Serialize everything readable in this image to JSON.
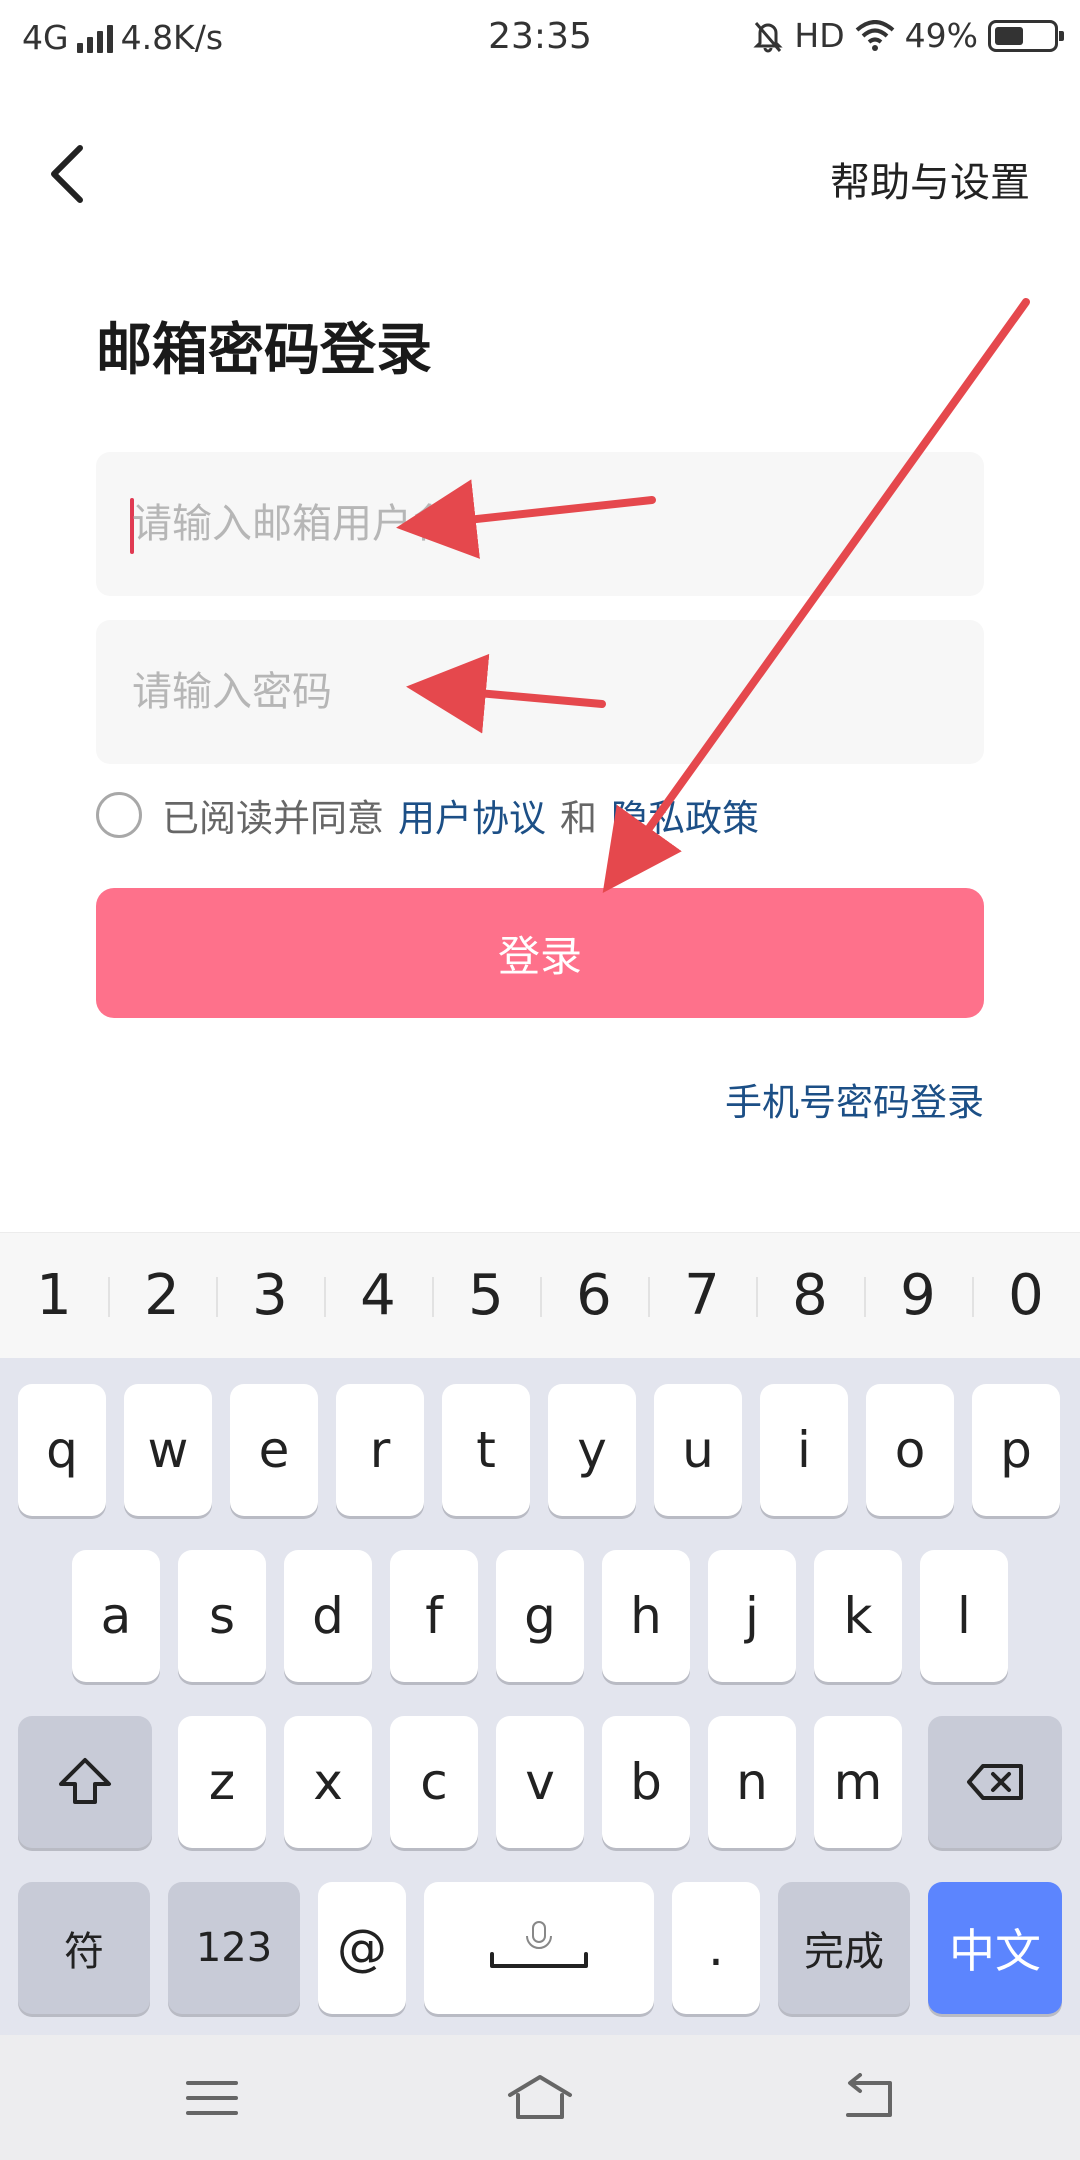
{
  "status_bar": {
    "network": "4G",
    "speed": "4.8K/s",
    "time": "23:35",
    "hd": "HD",
    "battery_text": "49%",
    "battery_level": 0.49
  },
  "header": {
    "back_icon": "chevron-left-icon",
    "help": "帮助与设置"
  },
  "title": "邮箱密码登录",
  "form": {
    "email_placeholder": "请输入邮箱用户名",
    "password_placeholder": "请输入密码"
  },
  "agreement": {
    "prefix": "已阅读并同意",
    "user_agreement": "用户协议",
    "and": "和",
    "privacy_policy": "隐私政策",
    "checked": false
  },
  "login_button": "登录",
  "phone_login": "手机号密码登录",
  "keyboard": {
    "numbers": [
      "1",
      "2",
      "3",
      "4",
      "5",
      "6",
      "7",
      "8",
      "9",
      "0"
    ],
    "row1": [
      "q",
      "w",
      "e",
      "r",
      "t",
      "y",
      "u",
      "i",
      "o",
      "p"
    ],
    "row2": [
      "a",
      "s",
      "d",
      "f",
      "g",
      "h",
      "j",
      "k",
      "l"
    ],
    "row3": [
      "z",
      "x",
      "c",
      "v",
      "b",
      "n",
      "m"
    ],
    "symbols": "符",
    "num_mode": "123",
    "at": "@",
    "period": ".",
    "done": "完成",
    "language": "中文",
    "shift_icon": "shift-arrow-icon",
    "backspace_icon": "backspace-icon",
    "mic_icon": "microphone-icon"
  },
  "nav_bar": {
    "menu_icon": "menu-icon",
    "home_icon": "home-icon",
    "back_icon": "back-arrow-icon"
  },
  "colors": {
    "login_button": "#fe718b",
    "link": "#1c4f86",
    "annotation_arrow": "#e5484d",
    "language_key": "#5c85fe"
  }
}
